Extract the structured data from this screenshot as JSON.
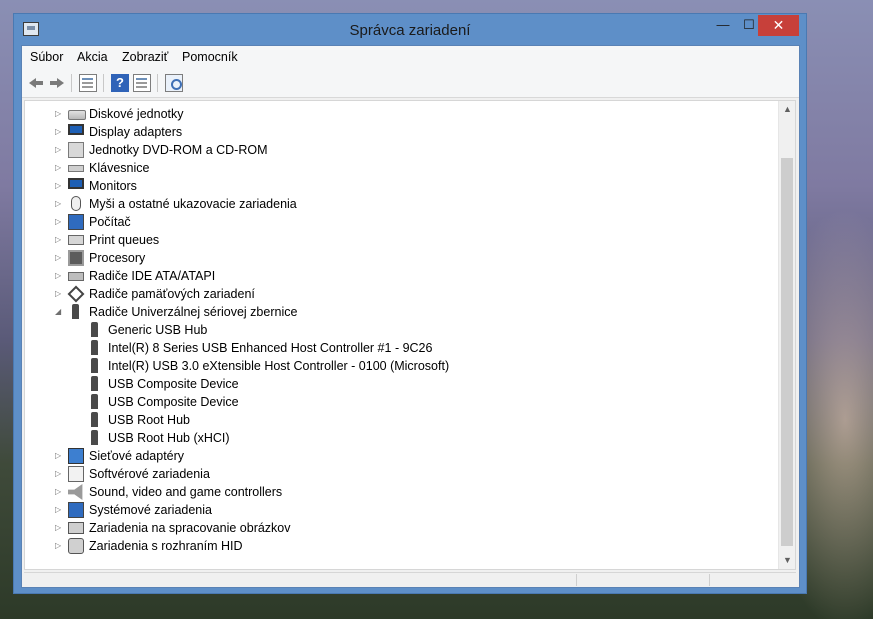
{
  "window": {
    "title": "Správca zariadení",
    "controls": {
      "minimize": "—",
      "maximize": "☐",
      "close": "✕"
    }
  },
  "menu": [
    {
      "label": "Súbor"
    },
    {
      "label": "Akcia"
    },
    {
      "label": "Zobraziť"
    },
    {
      "label": "Pomocník"
    }
  ],
  "toolbar": {
    "help_glyph": "?"
  },
  "tree": [
    {
      "label": "Diskové jednotky",
      "level": 0,
      "expander": "collapsed",
      "icon": "disk-drive-icon"
    },
    {
      "label": "Display adapters",
      "level": 0,
      "expander": "collapsed",
      "icon": "display-adapter-icon"
    },
    {
      "label": "Jednotky DVD-ROM a CD-ROM",
      "level": 0,
      "expander": "collapsed",
      "icon": "dvd-drive-icon"
    },
    {
      "label": "Klávesnice",
      "level": 0,
      "expander": "collapsed",
      "icon": "keyboard-icon"
    },
    {
      "label": "Monitors",
      "level": 0,
      "expander": "collapsed",
      "icon": "monitor-icon"
    },
    {
      "label": "Myši a ostatné ukazovacie zariadenia",
      "level": 0,
      "expander": "collapsed",
      "icon": "mouse-icon"
    },
    {
      "label": "Počítač",
      "level": 0,
      "expander": "collapsed",
      "icon": "computer-icon"
    },
    {
      "label": "Print queues",
      "level": 0,
      "expander": "collapsed",
      "icon": "printer-icon"
    },
    {
      "label": "Procesory",
      "level": 0,
      "expander": "collapsed",
      "icon": "processor-icon"
    },
    {
      "label": "Radiče IDE ATA/ATAPI",
      "level": 0,
      "expander": "collapsed",
      "icon": "ide-controller-icon"
    },
    {
      "label": "Radiče pamäťových zariadení",
      "level": 0,
      "expander": "collapsed",
      "icon": "storage-controller-icon"
    },
    {
      "label": "Radiče Univerzálnej sériovej zbernice",
      "level": 0,
      "expander": "expanded",
      "icon": "usb-controller-icon"
    },
    {
      "label": "Generic USB Hub",
      "level": 1,
      "expander": "none",
      "icon": "usb-device-icon"
    },
    {
      "label": "Intel(R) 8 Series USB Enhanced Host Controller #1 - 9C26",
      "level": 1,
      "expander": "none",
      "icon": "usb-device-icon"
    },
    {
      "label": "Intel(R) USB 3.0 eXtensible Host Controller - 0100 (Microsoft)",
      "level": 1,
      "expander": "none",
      "icon": "usb-device-icon"
    },
    {
      "label": "USB Composite Device",
      "level": 1,
      "expander": "none",
      "icon": "usb-device-icon"
    },
    {
      "label": "USB Composite Device",
      "level": 1,
      "expander": "none",
      "icon": "usb-device-icon"
    },
    {
      "label": "USB Root Hub",
      "level": 1,
      "expander": "none",
      "icon": "usb-device-icon"
    },
    {
      "label": "USB Root Hub (xHCI)",
      "level": 1,
      "expander": "none",
      "icon": "usb-device-icon"
    },
    {
      "label": "Sieťové adaptéry",
      "level": 0,
      "expander": "collapsed",
      "icon": "network-adapter-icon"
    },
    {
      "label": "Softvérové zariadenia",
      "level": 0,
      "expander": "collapsed",
      "icon": "software-device-icon"
    },
    {
      "label": "Sound, video and game controllers",
      "level": 0,
      "expander": "collapsed",
      "icon": "sound-icon"
    },
    {
      "label": "Systémové zariadenia",
      "level": 0,
      "expander": "collapsed",
      "icon": "system-device-icon"
    },
    {
      "label": "Zariadenia na spracovanie obrázkov",
      "level": 0,
      "expander": "collapsed",
      "icon": "imaging-device-icon"
    },
    {
      "label": "Zariadenia s rozhraním HID",
      "level": 0,
      "expander": "collapsed",
      "icon": "hid-device-icon"
    }
  ]
}
